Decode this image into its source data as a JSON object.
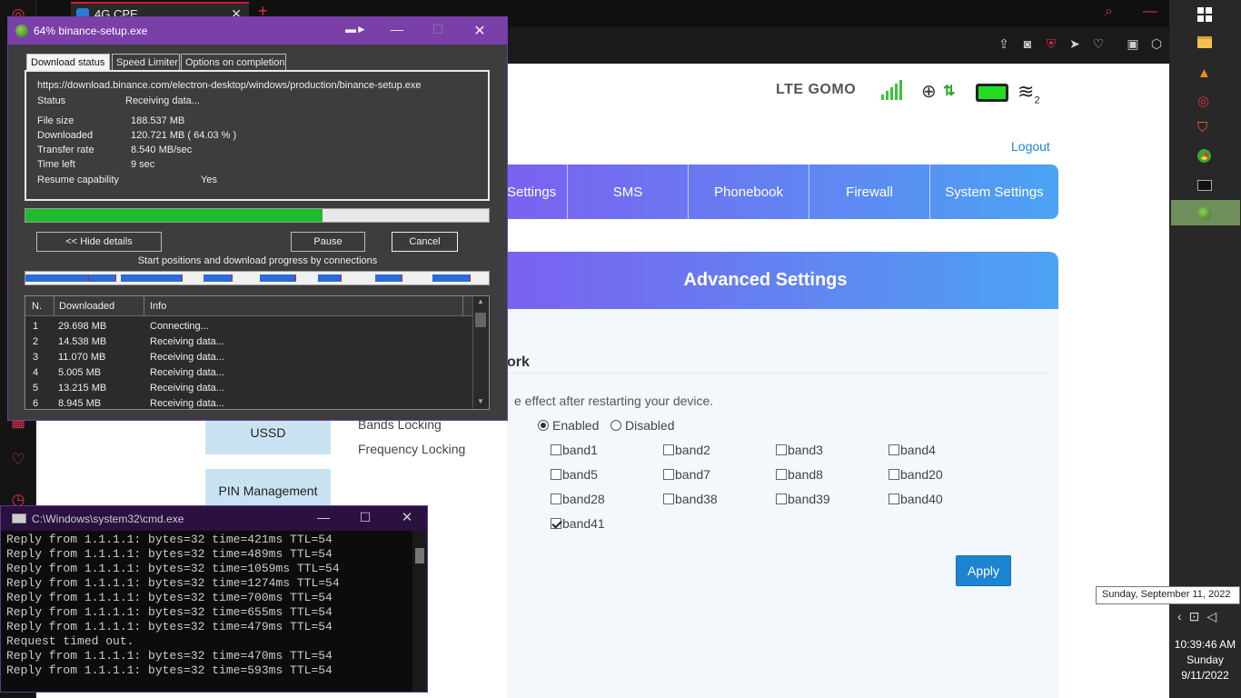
{
  "browser": {
    "tab_title": "4G CPE",
    "tab_close": "✕",
    "new_tab": "+"
  },
  "router": {
    "carrier_text": "LTE  GOMO",
    "wifi_clients": "2",
    "logout": "Logout",
    "nav": [
      "Settings",
      "SMS",
      "Phonebook",
      "Firewall",
      "System Settings"
    ],
    "header": "Advanced Settings",
    "section_title": "ork",
    "restart_note": "e effect after restarting your device.",
    "side_menu": [
      "USSD",
      "PIN Management"
    ],
    "bands_locking_label": "Bands Locking",
    "bands_locking_options": [
      "Enabled",
      "Disabled"
    ],
    "bands_locking_selected": "Enabled",
    "frequency_locking_label": "Frequency Locking",
    "bands": [
      {
        "label": "band1",
        "checked": false
      },
      {
        "label": "band2",
        "checked": false
      },
      {
        "label": "band3",
        "checked": false
      },
      {
        "label": "band4",
        "checked": false
      },
      {
        "label": "band5",
        "checked": false
      },
      {
        "label": "band7",
        "checked": false
      },
      {
        "label": "band8",
        "checked": false
      },
      {
        "label": "band20",
        "checked": false
      },
      {
        "label": "band28",
        "checked": false
      },
      {
        "label": "band38",
        "checked": false
      },
      {
        "label": "band39",
        "checked": false
      },
      {
        "label": "band40",
        "checked": false
      },
      {
        "label": "band41",
        "checked": true
      }
    ],
    "apply": "Apply"
  },
  "idm": {
    "title": "64% binance-setup.exe",
    "tabs": [
      "Download status",
      "Speed Limiter",
      "Options on completion"
    ],
    "url": "https://download.binance.com/electron-desktop/windows/production/binance-setup.exe",
    "status_label": "Status",
    "status_value": "Receiving data...",
    "file_size_label": "File size",
    "file_size_value": "188.537  MB",
    "downloaded_label": "Downloaded",
    "downloaded_value": "120.721  MB  ( 64.03 % )",
    "transfer_rate_label": "Transfer rate",
    "transfer_rate_value": "8.540  MB/sec",
    "time_left_label": "Time left",
    "time_left_value": "9 sec",
    "resume_label": "Resume capability",
    "resume_value": "Yes",
    "progress_fraction": 0.6403,
    "hide_details": "<< Hide details",
    "pause": "Pause",
    "cancel": "Cancel",
    "connections_caption": "Start positions and download progress by connections",
    "table_headers": [
      "N.",
      "Downloaded",
      "Info"
    ],
    "connections": [
      {
        "n": "1",
        "downloaded": "29.698  MB",
        "info": "Connecting..."
      },
      {
        "n": "2",
        "downloaded": "14.538  MB",
        "info": "Receiving data..."
      },
      {
        "n": "3",
        "downloaded": "11.070  MB",
        "info": "Receiving data..."
      },
      {
        "n": "4",
        "downloaded": "5.005  MB",
        "info": "Receiving data..."
      },
      {
        "n": "5",
        "downloaded": "13.215  MB",
        "info": "Receiving data..."
      },
      {
        "n": "6",
        "downloaded": "8.945  MB",
        "info": "Receiving data..."
      }
    ]
  },
  "cmd": {
    "title": "C:\\Windows\\system32\\cmd.exe",
    "lines": [
      "Reply from 1.1.1.1: bytes=32 time=421ms TTL=54",
      "Reply from 1.1.1.1: bytes=32 time=489ms TTL=54",
      "Reply from 1.1.1.1: bytes=32 time=1059ms TTL=54",
      "Reply from 1.1.1.1: bytes=32 time=1274ms TTL=54",
      "Reply from 1.1.1.1: bytes=32 time=700ms TTL=54",
      "Reply from 1.1.1.1: bytes=32 time=655ms TTL=54",
      "Reply from 1.1.1.1: bytes=32 time=479ms TTL=54",
      "Request timed out.",
      "Reply from 1.1.1.1: bytes=32 time=470ms TTL=54",
      "Reply from 1.1.1.1: bytes=32 time=593ms TTL=54"
    ]
  },
  "taskbar": {
    "tooltip": "Sunday, September 11, 2022",
    "time": "10:39:46 AM",
    "day": "Sunday",
    "date": "9/11/2022",
    "icons": [
      "windows-start-icon",
      "file-explorer-icon",
      "vlc-icon",
      "opera-icon",
      "brave-icon",
      "chrome-icon",
      "cmd-icon",
      "idm-icon"
    ]
  },
  "colors": {
    "accent_purple": "#7a3fa8",
    "nav_gradient_start": "#7b61f0",
    "nav_gradient_end": "#4ba3f3",
    "apply_blue": "#1d84d1",
    "progress_green": "#1fbb2f",
    "browser_red": "#e0304a"
  }
}
